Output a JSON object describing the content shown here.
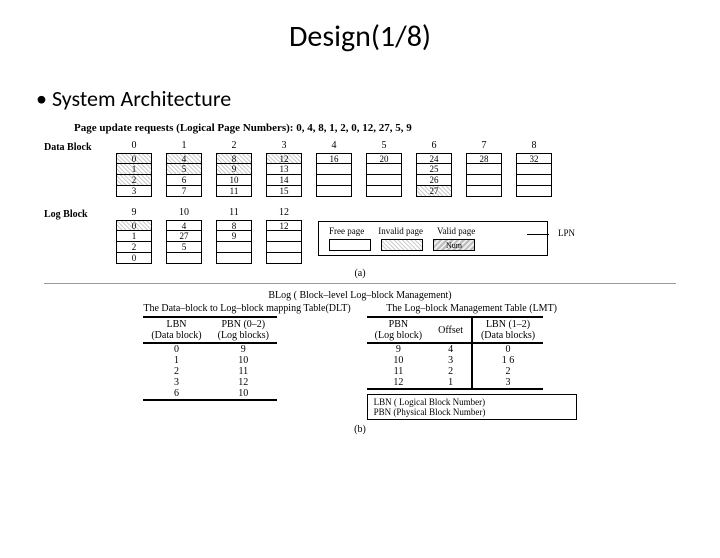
{
  "title": "Design(1/8)",
  "bullet": "System Architecture",
  "request_line": "Page update requests (Logical Page Numbers):   0, 4, 8, 1, 2, 0, 12, 27, 5, 9",
  "data_block_label": "Data Block",
  "log_block_label": "Log Block",
  "data_blocks": [
    {
      "hdr": "0",
      "cells": [
        {
          "v": "0",
          "s": "inv"
        },
        {
          "v": "1",
          "s": "inv"
        },
        {
          "v": "2",
          "s": "inv"
        },
        {
          "v": "3",
          "s": ""
        }
      ]
    },
    {
      "hdr": "1",
      "cells": [
        {
          "v": "4",
          "s": "inv"
        },
        {
          "v": "5",
          "s": "inv"
        },
        {
          "v": "6",
          "s": ""
        },
        {
          "v": "7",
          "s": ""
        }
      ]
    },
    {
      "hdr": "2",
      "cells": [
        {
          "v": "8",
          "s": "inv"
        },
        {
          "v": "9",
          "s": "inv"
        },
        {
          "v": "10",
          "s": ""
        },
        {
          "v": "11",
          "s": ""
        }
      ]
    },
    {
      "hdr": "3",
      "cells": [
        {
          "v": "12",
          "s": "inv"
        },
        {
          "v": "13",
          "s": ""
        },
        {
          "v": "14",
          "s": ""
        },
        {
          "v": "15",
          "s": ""
        }
      ]
    },
    {
      "hdr": "4",
      "cells": [
        {
          "v": "16",
          "s": ""
        },
        {
          "v": "",
          "s": ""
        },
        {
          "v": "",
          "s": ""
        },
        {
          "v": "",
          "s": ""
        }
      ]
    },
    {
      "hdr": "5",
      "cells": [
        {
          "v": "20",
          "s": ""
        },
        {
          "v": "",
          "s": ""
        },
        {
          "v": "",
          "s": ""
        },
        {
          "v": "",
          "s": ""
        }
      ]
    },
    {
      "hdr": "6",
      "cells": [
        {
          "v": "24",
          "s": ""
        },
        {
          "v": "25",
          "s": ""
        },
        {
          "v": "26",
          "s": ""
        },
        {
          "v": "27",
          "s": "inv"
        }
      ]
    },
    {
      "hdr": "7",
      "cells": [
        {
          "v": "28",
          "s": ""
        },
        {
          "v": "",
          "s": ""
        },
        {
          "v": "",
          "s": ""
        },
        {
          "v": "",
          "s": ""
        }
      ]
    },
    {
      "hdr": "8",
      "cells": [
        {
          "v": "32",
          "s": ""
        },
        {
          "v": "",
          "s": ""
        },
        {
          "v": "",
          "s": ""
        },
        {
          "v": "",
          "s": ""
        }
      ]
    }
  ],
  "log_blocks": [
    {
      "hdr": "9",
      "cells": [
        {
          "v": "0",
          "s": "inv"
        },
        {
          "v": "1",
          "s": ""
        },
        {
          "v": "2",
          "s": ""
        },
        {
          "v": "0",
          "s": ""
        }
      ]
    },
    {
      "hdr": "10",
      "cells": [
        {
          "v": "4",
          "s": ""
        },
        {
          "v": "27",
          "s": ""
        },
        {
          "v": "5",
          "s": ""
        },
        {
          "v": "",
          "s": ""
        }
      ]
    },
    {
      "hdr": "11",
      "cells": [
        {
          "v": "8",
          "s": ""
        },
        {
          "v": "9",
          "s": ""
        },
        {
          "v": "",
          "s": ""
        },
        {
          "v": "",
          "s": ""
        }
      ]
    },
    {
      "hdr": "12",
      "cells": [
        {
          "v": "12",
          "s": ""
        },
        {
          "v": "",
          "s": ""
        },
        {
          "v": "",
          "s": ""
        },
        {
          "v": "",
          "s": ""
        }
      ]
    }
  ],
  "legend": {
    "free": "Free page",
    "invalid": "Invalid page",
    "valid": "Valid page",
    "num": "Num",
    "lpn": "LPN"
  },
  "caption_a": "(a)",
  "caption_b": "(b)",
  "blog_title": "BLog  ( Block–level  Log–block Management)",
  "dlt_caption": "The Data–block to Log–block mapping Table(DLT)",
  "lmt_caption": "The Log–block Management Table (LMT)",
  "dlt": {
    "headers": [
      "LBN\n(Data block)",
      "PBN (0–2)\n(Log blocks)"
    ],
    "rows": [
      [
        "0",
        "9"
      ],
      [
        "1",
        "10"
      ],
      [
        "2",
        "11"
      ],
      [
        "3",
        "12"
      ],
      [
        "6",
        "10"
      ]
    ]
  },
  "lmt": {
    "headers": [
      "PBN\n(Log block)",
      "Offset",
      "LBN (1–2)\n(Data blocks)"
    ],
    "rows": [
      [
        "9",
        "4",
        "0"
      ],
      [
        "10",
        "3",
        "1        6"
      ],
      [
        "11",
        "2",
        "2"
      ],
      [
        "12",
        "1",
        "3"
      ]
    ]
  },
  "footnotes": {
    "lbn": "LBN ( Logical Block Number)",
    "pbn": "PBN (Physical Block Number)"
  }
}
